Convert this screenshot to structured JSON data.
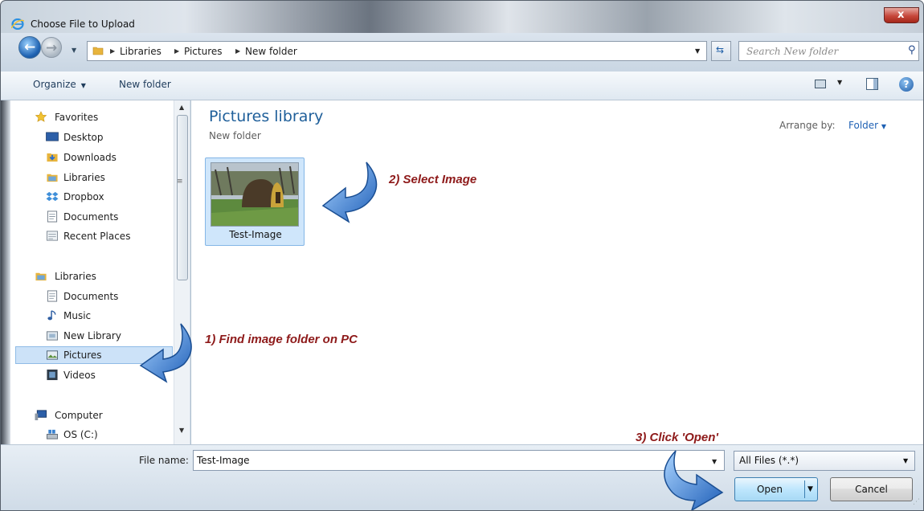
{
  "window": {
    "title": "Choose File to Upload",
    "close_glyph": "x"
  },
  "nav": {
    "back_glyph": "←",
    "forward_glyph": "→",
    "breadcrumbs": [
      "Libraries",
      "Pictures",
      "New folder"
    ],
    "search_placeholder": "Search New folder"
  },
  "toolbar": {
    "organize_label": "Organize",
    "new_folder_label": "New folder",
    "help_glyph": "?"
  },
  "sidebar": {
    "favorites_header": "Favorites",
    "favorites": [
      "Desktop",
      "Downloads",
      "Libraries",
      "Dropbox",
      "Documents",
      "Recent Places"
    ],
    "libraries_header": "Libraries",
    "libraries": [
      "Documents",
      "Music",
      "New Library",
      "Pictures",
      "Videos"
    ],
    "computer_header": "Computer",
    "computer": [
      "OS (C:)"
    ],
    "selected": "Pictures"
  },
  "content": {
    "title": "Pictures library",
    "subtitle": "New folder",
    "arrange_label": "Arrange by:",
    "arrange_value": "Folder",
    "files": [
      {
        "name": "Test-Image"
      }
    ]
  },
  "annotations": {
    "step1": "1) Find image folder on PC",
    "step2": "2) Select Image",
    "step3": "3) Click 'Open'"
  },
  "footer": {
    "filename_label": "File name:",
    "filename_value": "Test-Image",
    "filter_value": "All Files (*.*)",
    "open_label": "Open",
    "cancel_label": "Cancel"
  },
  "colors": {
    "accent_blue": "#1f5f9a",
    "annotation_red": "#8e1a1a",
    "selection": "#cce2f8"
  }
}
